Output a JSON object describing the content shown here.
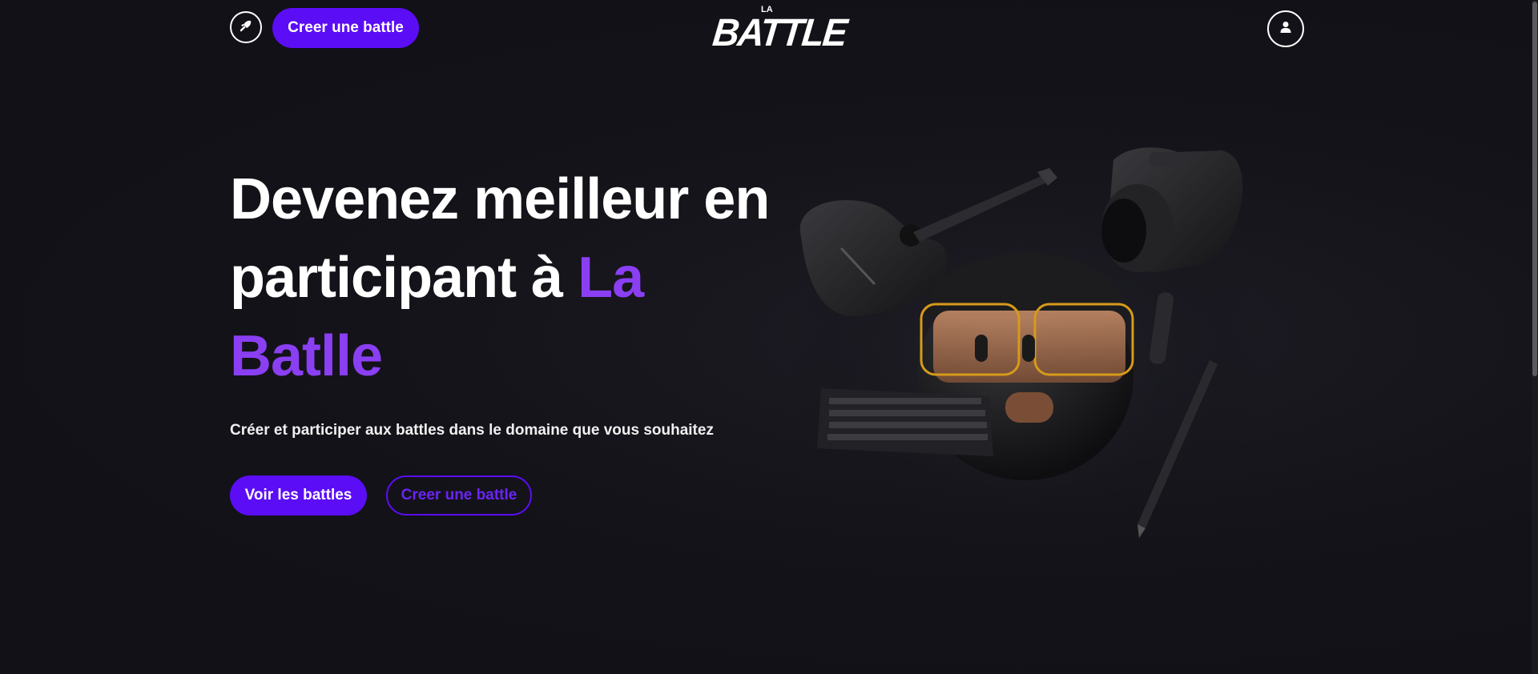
{
  "header": {
    "rocket_icon": "rocket-icon",
    "create_label": "Creer une battle",
    "logo_small": "LA",
    "logo_main": "BATTLE",
    "user_icon": "user-icon"
  },
  "hero": {
    "title_part1": "Devenez meilleur en participant à ",
    "title_accent": "La Batlle",
    "subtitle": "Créer et participer aux battles dans le domaine que vous souhaitez",
    "primary_cta": "Voir les battles",
    "secondary_cta": "Creer une battle"
  },
  "colors": {
    "accent": "#5b0df5",
    "accent_text": "#8a3ff2",
    "background": "#121118"
  }
}
